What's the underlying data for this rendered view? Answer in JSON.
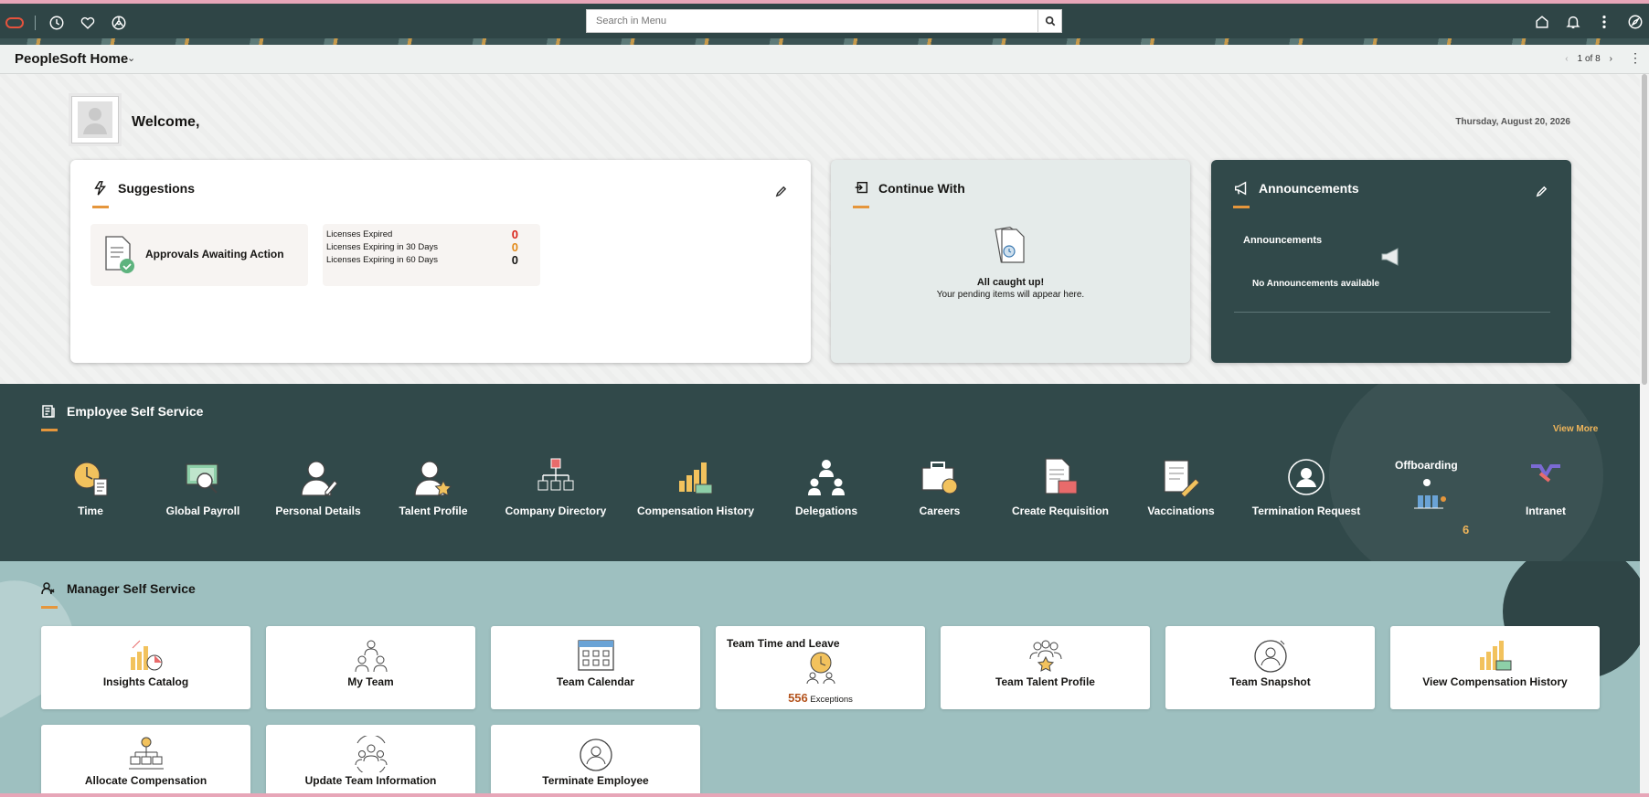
{
  "topbar": {
    "search_placeholder": "Search in Menu",
    "left_icons": [
      "oracle-logo",
      "recent-icon",
      "favorites-icon",
      "navigator-icon"
    ],
    "right_icons": [
      "home-icon",
      "bell-icon",
      "more-icon",
      "navbar-icon"
    ]
  },
  "titlebar": {
    "title": "PeopleSoft Home",
    "pager": "1 of 8"
  },
  "welcome": {
    "greeting": "Welcome,",
    "date": "Thursday, August 20, 2026"
  },
  "suggestions": {
    "title": "Suggestions",
    "approvals_label": "Approvals Awaiting Action",
    "licenses": [
      {
        "label": "Licenses Expired",
        "value": "0",
        "color": "#d9231a"
      },
      {
        "label": "Licenses Expiring in 30 Days",
        "value": "0",
        "color": "#e28a1a"
      },
      {
        "label": "Licenses Expiring in 60 Days",
        "value": "0",
        "color": "#161513"
      }
    ]
  },
  "continue_with": {
    "title": "Continue With",
    "status_title": "All caught up!",
    "status_sub": "Your pending items will appear here."
  },
  "announcements": {
    "title": "Announcements",
    "sub_title": "Announcements",
    "empty_text": "No Announcements available"
  },
  "ess": {
    "title": "Employee Self Service",
    "view_more": "View More",
    "tiles": [
      {
        "label": "Time",
        "icon": "clock-icon"
      },
      {
        "label": "Global Payroll",
        "icon": "payroll-icon"
      },
      {
        "label": "Personal Details",
        "icon": "person-edit-icon"
      },
      {
        "label": "Talent Profile",
        "icon": "person-star-icon"
      },
      {
        "label": "Company Directory",
        "icon": "org-chart-icon"
      },
      {
        "label": "Compensation History",
        "icon": "compensation-icon"
      },
      {
        "label": "Delegations",
        "icon": "delegation-icon"
      },
      {
        "label": "Careers",
        "icon": "briefcase-icon"
      },
      {
        "label": "Create Requisition",
        "icon": "requisition-icon"
      },
      {
        "label": "Vaccinations",
        "icon": "vaccination-icon"
      },
      {
        "label": "Termination Request",
        "icon": "termination-icon"
      },
      {
        "label": "Intranet",
        "icon": "intranet-icon"
      }
    ],
    "offboarding": {
      "label": "Offboarding",
      "count": "6"
    }
  },
  "mss": {
    "title": "Manager Self Service",
    "tiles": [
      {
        "label": "Insights Catalog",
        "icon": "insights-icon"
      },
      {
        "label": "My Team",
        "icon": "team-icon"
      },
      {
        "label": "Team Calendar",
        "icon": "calendar-icon"
      },
      {
        "label": "Team Time and Leave",
        "icon": "team-time-icon",
        "count": "556",
        "count_label": "Exceptions"
      },
      {
        "label": "Team Talent Profile",
        "icon": "team-talent-icon"
      },
      {
        "label": "Team Snapshot",
        "icon": "snapshot-icon"
      },
      {
        "label": "View Compensation History",
        "icon": "compensation-icon"
      },
      {
        "label": "Allocate Compensation",
        "icon": "allocate-icon"
      },
      {
        "label": "Update Team Information",
        "icon": "update-team-icon"
      },
      {
        "label": "Terminate Employee",
        "icon": "terminate-icon"
      }
    ]
  },
  "colors": {
    "header_dark": "#2f4546",
    "ess_bg": "#31494a",
    "mss_bg": "#9ec0c0",
    "accent_orange": "#e5963c"
  }
}
